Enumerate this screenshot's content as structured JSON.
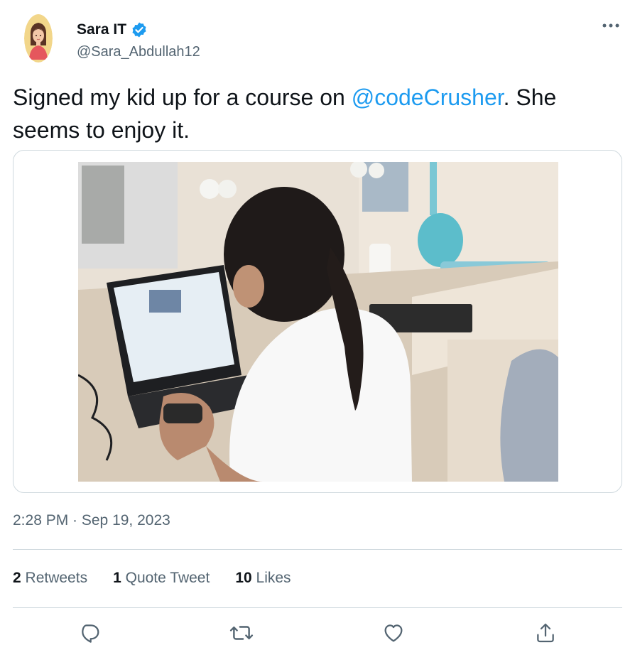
{
  "tweet": {
    "display_name": "Sara IT",
    "handle": "@Sara_Abdullah12",
    "text_before": "Signed my kid up for a course on ",
    "mention": "@codeCrusher",
    "text_after": ". She seems to enjoy it.",
    "timestamp": "2:28 PM · Sep 19, 2023"
  },
  "stats": {
    "retweets_count": "2",
    "retweets_label": "Retweets",
    "quotes_count": "1",
    "quotes_label": "Quote Tweet",
    "likes_count": "10",
    "likes_label": "Likes"
  },
  "icons": {
    "more": "more-horizontal-icon",
    "verified": "verified-badge-icon",
    "reply": "reply-icon",
    "retweet": "retweet-icon",
    "like": "heart-icon",
    "share": "share-icon"
  },
  "colors": {
    "accent": "#1d9bf0",
    "text_primary": "#0f1419",
    "text_secondary": "#536471",
    "border": "#cfd9de"
  }
}
